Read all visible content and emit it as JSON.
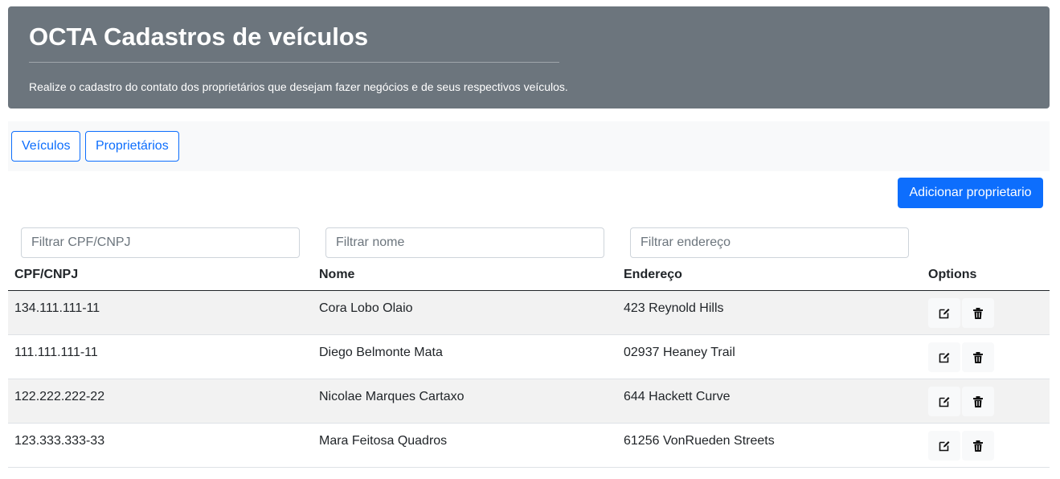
{
  "header": {
    "title": "OCTA Cadastros de veículos",
    "subtitle": "Realize o cadastro do contato dos proprietários que desejam fazer negócios e de seus respectivos veículos."
  },
  "nav": {
    "vehicles_label": "Veículos",
    "owners_label": "Proprietários"
  },
  "actions": {
    "add_owner_label": "Adicionar proprietario"
  },
  "filters": {
    "cpf_placeholder": "Filtrar CPF/CNPJ",
    "name_placeholder": "Filtrar nome",
    "address_placeholder": "Filtrar endereço"
  },
  "table": {
    "columns": [
      "CPF/CNPJ",
      "Nome",
      "Endereço",
      "Options"
    ],
    "rows": [
      {
        "cpf": "134.111.111-11",
        "name": "Cora Lobo Olaio",
        "address": "423 Reynold Hills"
      },
      {
        "cpf": "111.111.111-11",
        "name": "Diego Belmonte Mata",
        "address": "02937 Heaney Trail"
      },
      {
        "cpf": "122.222.222-22",
        "name": "Nicolae Marques Cartaxo",
        "address": "644 Hackett Curve"
      },
      {
        "cpf": "123.333.333-33",
        "name": "Mara Feitosa Quadros",
        "address": "61256 VonRueden Streets"
      }
    ]
  },
  "icons": {
    "edit": "edit-icon",
    "delete": "trash-icon"
  },
  "colors": {
    "header_bg": "#6c757d",
    "primary": "#0d6efd",
    "stripe": "#f2f2f2"
  }
}
